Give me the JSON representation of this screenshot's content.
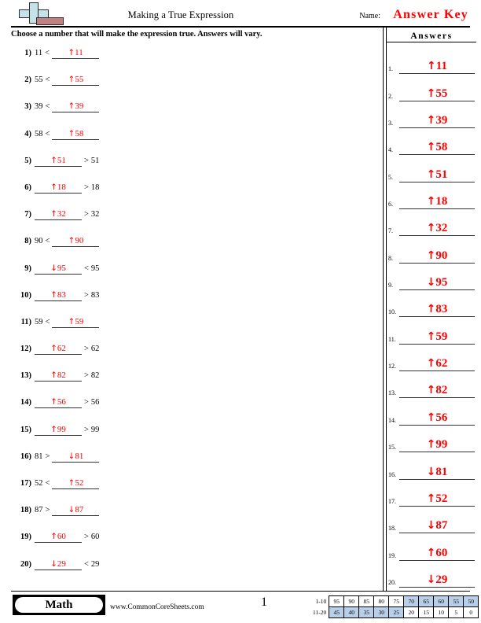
{
  "header": {
    "title": "Making a True Expression",
    "name_label": "Name:",
    "answer_key": "Answer Key",
    "logo_icon": "plus-blocks-icon"
  },
  "instruction": "Choose a number that will make the expression true. Answers will vary.",
  "problems": [
    {
      "n": "1)",
      "layout": "right_blank",
      "left": "11",
      "op": "<",
      "answer": "11",
      "arrow": "↑"
    },
    {
      "n": "2)",
      "layout": "right_blank",
      "left": "55",
      "op": "<",
      "answer": "55",
      "arrow": "↑"
    },
    {
      "n": "3)",
      "layout": "right_blank",
      "left": "39",
      "op": "<",
      "answer": "39",
      "arrow": "↑"
    },
    {
      "n": "4)",
      "layout": "right_blank",
      "left": "58",
      "op": "<",
      "answer": "58",
      "arrow": "↑"
    },
    {
      "n": "5)",
      "layout": "left_blank",
      "right": "51",
      "op": ">",
      "answer": "51",
      "arrow": "↑"
    },
    {
      "n": "6)",
      "layout": "left_blank",
      "right": "18",
      "op": ">",
      "answer": "18",
      "arrow": "↑"
    },
    {
      "n": "7)",
      "layout": "left_blank",
      "right": "32",
      "op": ">",
      "answer": "32",
      "arrow": "↑"
    },
    {
      "n": "8)",
      "layout": "right_blank",
      "left": "90",
      "op": "<",
      "answer": "90",
      "arrow": "↑"
    },
    {
      "n": "9)",
      "layout": "left_blank",
      "right": "95",
      "op": "<",
      "answer": "95",
      "arrow": "↓"
    },
    {
      "n": "10)",
      "layout": "left_blank",
      "right": "83",
      "op": ">",
      "answer": "83",
      "arrow": "↑"
    },
    {
      "n": "11)",
      "layout": "right_blank",
      "left": "59",
      "op": "<",
      "answer": "59",
      "arrow": "↑"
    },
    {
      "n": "12)",
      "layout": "left_blank",
      "right": "62",
      "op": ">",
      "answer": "62",
      "arrow": "↑"
    },
    {
      "n": "13)",
      "layout": "left_blank",
      "right": "82",
      "op": ">",
      "answer": "82",
      "arrow": "↑"
    },
    {
      "n": "14)",
      "layout": "left_blank",
      "right": "56",
      "op": ">",
      "answer": "56",
      "arrow": "↑"
    },
    {
      "n": "15)",
      "layout": "left_blank",
      "right": "99",
      "op": ">",
      "answer": "99",
      "arrow": "↑"
    },
    {
      "n": "16)",
      "layout": "right_blank",
      "left": "81",
      "op": ">",
      "answer": "81",
      "arrow": "↓"
    },
    {
      "n": "17)",
      "layout": "right_blank",
      "left": "52",
      "op": "<",
      "answer": "52",
      "arrow": "↑"
    },
    {
      "n": "18)",
      "layout": "right_blank",
      "left": "87",
      "op": ">",
      "answer": "87",
      "arrow": "↓"
    },
    {
      "n": "19)",
      "layout": "left_blank",
      "right": "60",
      "op": ">",
      "answer": "60",
      "arrow": "↑"
    },
    {
      "n": "20)",
      "layout": "left_blank",
      "right": "29",
      "op": "<",
      "answer": "29",
      "arrow": "↓"
    }
  ],
  "answers_column": {
    "title": "Answers",
    "items": [
      {
        "num": "1.",
        "arrow": "↑",
        "value": "11"
      },
      {
        "num": "2.",
        "arrow": "↑",
        "value": "55"
      },
      {
        "num": "3.",
        "arrow": "↑",
        "value": "39"
      },
      {
        "num": "4.",
        "arrow": "↑",
        "value": "58"
      },
      {
        "num": "5.",
        "arrow": "↑",
        "value": "51"
      },
      {
        "num": "6.",
        "arrow": "↑",
        "value": "18"
      },
      {
        "num": "7.",
        "arrow": "↑",
        "value": "32"
      },
      {
        "num": "8.",
        "arrow": "↑",
        "value": "90"
      },
      {
        "num": "9.",
        "arrow": "↓",
        "value": "95"
      },
      {
        "num": "10.",
        "arrow": "↑",
        "value": "83"
      },
      {
        "num": "11.",
        "arrow": "↑",
        "value": "59"
      },
      {
        "num": "12.",
        "arrow": "↑",
        "value": "62"
      },
      {
        "num": "13.",
        "arrow": "↑",
        "value": "82"
      },
      {
        "num": "14.",
        "arrow": "↑",
        "value": "56"
      },
      {
        "num": "15.",
        "arrow": "↑",
        "value": "99"
      },
      {
        "num": "16.",
        "arrow": "↓",
        "value": "81"
      },
      {
        "num": "17.",
        "arrow": "↑",
        "value": "52"
      },
      {
        "num": "18.",
        "arrow": "↓",
        "value": "87"
      },
      {
        "num": "19.",
        "arrow": "↑",
        "value": "60"
      },
      {
        "num": "20.",
        "arrow": "↓",
        "value": "29"
      }
    ]
  },
  "footer": {
    "subject_badge": "Math",
    "site_url": "www.CommonCoreSheets.com",
    "page_number": "1",
    "scale": {
      "row1_label": "1-10",
      "row2_label": "11-20",
      "row1": [
        {
          "v": "95",
          "hl": false
        },
        {
          "v": "90",
          "hl": false
        },
        {
          "v": "85",
          "hl": false
        },
        {
          "v": "80",
          "hl": false
        },
        {
          "v": "75",
          "hl": false
        },
        {
          "v": "70",
          "hl": true
        },
        {
          "v": "65",
          "hl": true
        },
        {
          "v": "60",
          "hl": true
        },
        {
          "v": "55",
          "hl": true
        },
        {
          "v": "50",
          "hl": true
        }
      ],
      "row2": [
        {
          "v": "45",
          "hl": true
        },
        {
          "v": "40",
          "hl": true
        },
        {
          "v": "35",
          "hl": true
        },
        {
          "v": "30",
          "hl": true
        },
        {
          "v": "25",
          "hl": true
        },
        {
          "v": "20",
          "hl": false
        },
        {
          "v": "15",
          "hl": false
        },
        {
          "v": "10",
          "hl": false
        },
        {
          "v": "5",
          "hl": false
        },
        {
          "v": "0",
          "hl": false
        }
      ]
    }
  },
  "colors": {
    "answer_red": "#ff0000",
    "logo_blue": "#c5e2e8",
    "logo_red": "#c08080",
    "scale_highlight": "#b8cfea"
  }
}
